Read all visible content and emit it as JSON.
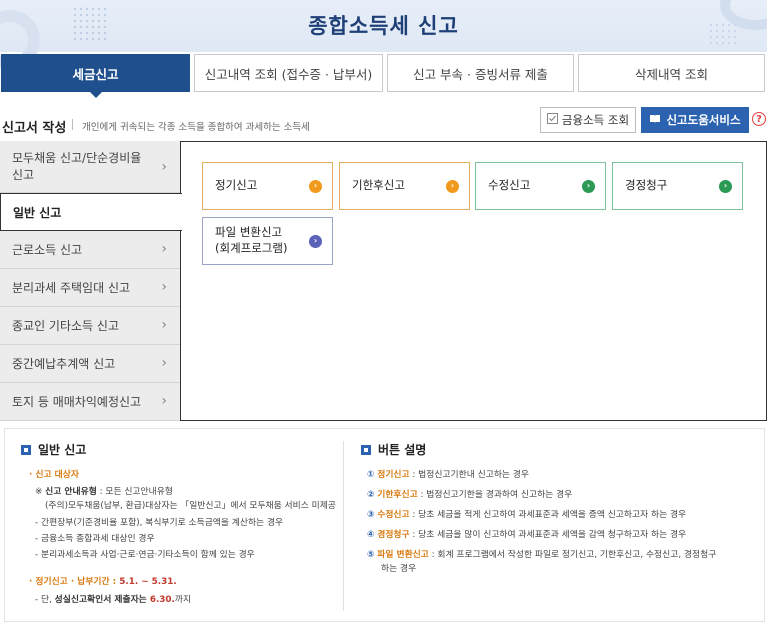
{
  "header": {
    "title": "종합소득세 신고"
  },
  "tabs": [
    {
      "label": "세금신고"
    },
    {
      "label": "신고내역 조회 (접수증 · 납부서)"
    },
    {
      "label": "신고 부속 · 증빙서류 제출"
    },
    {
      "label": "삭제내역 조회"
    }
  ],
  "section": {
    "title": "신고서 작성",
    "desc": "개인에게 귀속되는 각종 소득을 종합하여 과세하는 소득세",
    "fin_button": "금융소득 조회",
    "help_button": "신고도움서비스",
    "qmark": "?"
  },
  "sidenav": [
    {
      "label": "모두채움 신고/단순경비율 신고"
    },
    {
      "label": "일반 신고"
    },
    {
      "label": "근로소득 신고"
    },
    {
      "label": "분리과세 주택임대 신고"
    },
    {
      "label": "종교인 기타소득 신고"
    },
    {
      "label": "중간예납추계액 신고"
    },
    {
      "label": "토지 등 매매차익예정신고"
    }
  ],
  "cards": [
    {
      "label": "정기신고"
    },
    {
      "label": "기한후신고"
    },
    {
      "label": "수정신고"
    },
    {
      "label": "경정청구"
    },
    {
      "label": "파일 변환신고\n(회계프로그램)"
    }
  ],
  "info_left": {
    "title": "일반 신고",
    "target_head": "· 신고 대상자",
    "l1_prefix": "※ ",
    "l1_bold": "신고 안내유형",
    "l1_rest": " : 모든 신고안내유형",
    "l2": "(주의)모두채움(납부, 환급)대상자는 「일반신고」에서 모두채움 서비스 미제공",
    "l3": "- 간편장부(기준경비율 포함), 복식부기로 소득금액을 계산하는 경우",
    "l4": "- 금융소득 종합과세 대상인 경우",
    "l5": "- 분리과세소득과 사업·근로·연금·기타소득이 함께 있는 경우",
    "period_head": "· 정기신고 · 납부기간 : ",
    "period_val": "5.1. ~ 5.31.",
    "n_prefix": "- 단, ",
    "n_bold": "성실신고확인서 제출자는",
    "n_date": " 6.30.",
    "n_end": "까지"
  },
  "info_right": {
    "title": "버튼 설명",
    "items": [
      {
        "num": "①",
        "name": "정기신고",
        "desc": " : 법정신고기한내 신고하는 경우"
      },
      {
        "num": "②",
        "name": "기한후신고",
        "desc": " : 법정신고기한을 경과하여 신고하는 경우"
      },
      {
        "num": "③",
        "name": "수정신고",
        "desc": " : 당초 세금을 적게 신고하여 과세표준과 세액을 증액 신고하고자 하는 경우"
      },
      {
        "num": "④",
        "name": "경정청구",
        "desc": " : 당초 세금을 많이 신고하여 과세표준과 세액을 감액 청구하고자 하는 경우"
      },
      {
        "num": "⑤",
        "name": "파일 변환신고",
        "desc": " : 회계 프로그램에서 작성한 파일로 정기신고, 기한후신고, 수정신고, 경정청구"
      }
    ],
    "item5_cont": "하는 경우"
  },
  "colors": {
    "primary": "#1f4f8c",
    "accent": "#2c63b0",
    "orange": "#f29a1e",
    "green": "#2a9a55"
  },
  "icons": [
    "chevron-right-icon",
    "check-icon",
    "book-icon",
    "question-icon",
    "arrow-circle-icon"
  ]
}
